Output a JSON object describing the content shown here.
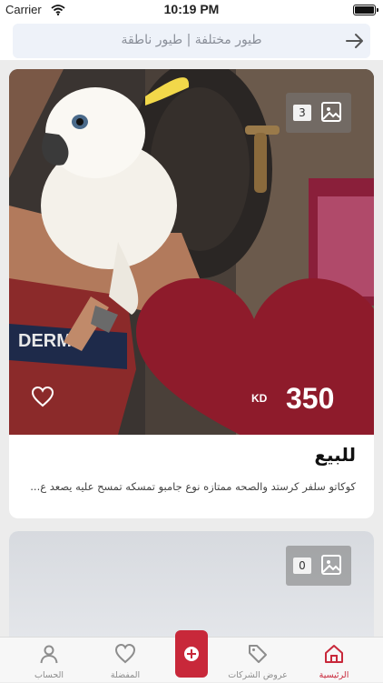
{
  "status_bar": {
    "carrier": "Carrier",
    "time": "10:19 PM"
  },
  "header": {
    "title": "طيور مختلفة | طيور ناطقة"
  },
  "listings": [
    {
      "image_count": "3",
      "price": "350",
      "currency": "KD",
      "title": "للبيع",
      "description": "كوكاتو سلفر كرستد والصحه ممتازه نوع جامبو تمسكه تمسح عليه يصعد ع..."
    },
    {
      "image_count": "0"
    }
  ],
  "tabbar": {
    "tabs": [
      {
        "label": "الرئيسية",
        "icon": "home-icon",
        "active": true
      },
      {
        "label": "عروض الشركات",
        "icon": "tag-icon",
        "active": false
      },
      {
        "label": "المفضلة",
        "icon": "heart-icon",
        "active": false
      },
      {
        "label": "الحساب",
        "icon": "user-icon",
        "active": false
      }
    ],
    "add_icon": "plus-icon"
  },
  "colors": {
    "accent": "#c8283a",
    "heart_overlay": "#8e1b2b"
  }
}
